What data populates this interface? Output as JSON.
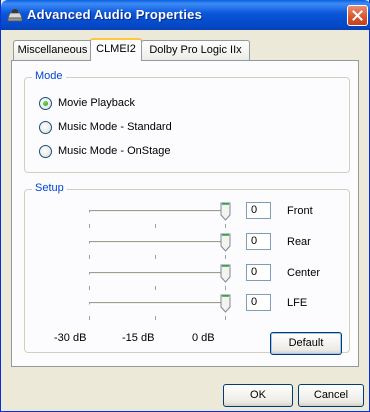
{
  "window": {
    "title": "Advanced Audio Properties"
  },
  "tabs": [
    {
      "label": "Miscellaneous",
      "active": false
    },
    {
      "label": "CLMEI2",
      "active": true
    },
    {
      "label": "Dolby Pro Logic IIx",
      "active": false
    }
  ],
  "mode": {
    "title": "Mode",
    "options": [
      {
        "label": "Movie Playback",
        "selected": true
      },
      {
        "label": "Music Mode - Standard",
        "selected": false
      },
      {
        "label": "Music Mode - OnStage",
        "selected": false
      }
    ]
  },
  "setup": {
    "title": "Setup",
    "channels": [
      {
        "label": "Front",
        "value": "0"
      },
      {
        "label": "Rear",
        "value": "0"
      },
      {
        "label": "Center",
        "value": "0"
      },
      {
        "label": "LFE",
        "value": "0"
      }
    ],
    "scale_labels": [
      "-30 dB",
      "-15 dB",
      "0 dB"
    ],
    "default_label": "Default"
  },
  "footer": {
    "ok_label": "OK",
    "cancel_label": "Cancel"
  },
  "colors": {
    "titlebar": "#0A56DA",
    "group_title": "#0046D5",
    "radio_dot": "#21A121",
    "active_tab_accent": "#FFC83C"
  }
}
